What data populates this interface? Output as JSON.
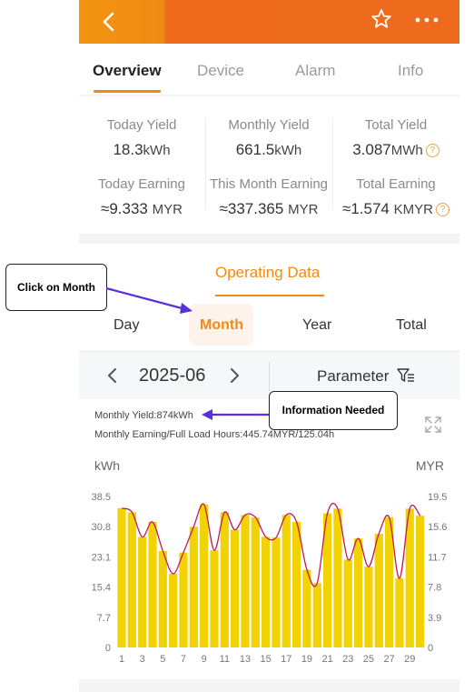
{
  "header": {
    "back_icon": "chevron-left-icon",
    "favorite_icon": "star-icon",
    "more_icon": "more-dots-icon",
    "gradient_left": "#f39410",
    "gradient_right": "#ee6a1c"
  },
  "tabs": [
    {
      "label": "Overview",
      "active": true
    },
    {
      "label": "Device",
      "active": false
    },
    {
      "label": "Alarm",
      "active": false
    },
    {
      "label": "Info",
      "active": false
    }
  ],
  "stats": {
    "today_yield": {
      "label": "Today Yield",
      "value": "18.3",
      "unit": "kWh"
    },
    "monthly_yield": {
      "label": "Monthly Yield",
      "value": "661.5",
      "unit": "kWh"
    },
    "total_yield": {
      "label": "Total Yield",
      "value": "3.087",
      "unit": "MWh"
    },
    "today_earning": {
      "label": "Today Earning",
      "value": "≈9.333",
      "unit": "MYR"
    },
    "month_earning": {
      "label": "This Month Earning",
      "value": "≈337.365",
      "unit": "MYR"
    },
    "total_earning": {
      "label": "Total Earning",
      "value": "≈1.574",
      "unit": "KMYR"
    },
    "help_glyph": "?"
  },
  "operating": {
    "title": "Operating Data",
    "periods": [
      "Day",
      "Month",
      "Year",
      "Total"
    ],
    "selected_period": "Month",
    "date": "2025-06",
    "parameter_label": "Parameter",
    "monthly_yield_text": "Monthly Yield:874kWh",
    "monthly_earning_text": "Monthly Earning/Full Load Hours:445.74MYR/125.04h"
  },
  "annotations": {
    "click_on_month": "Click on Month",
    "information_needed": "Information Needed",
    "arrow_color": "#5b2de0"
  },
  "chart_data": {
    "type": "bar",
    "left_axis_label": "kWh",
    "right_axis_label": "MYR",
    "y_ticks_left": [
      "0",
      "7.7",
      "15.4",
      "23.1",
      "30.8",
      "38.5"
    ],
    "y_ticks_right": [
      "0",
      "3.9",
      "7.8",
      "11.7",
      "15.6",
      "19.5"
    ],
    "ylim": [
      0,
      38.5
    ],
    "x_tick_labels": [
      "1",
      "3",
      "5",
      "7",
      "9",
      "11",
      "13",
      "15",
      "17",
      "19",
      "21",
      "23",
      "25",
      "27",
      "29"
    ],
    "categories": [
      "1",
      "2",
      "3",
      "4",
      "5",
      "6",
      "7",
      "8",
      "9",
      "10",
      "11",
      "12",
      "13",
      "14",
      "15",
      "16",
      "17",
      "18",
      "19",
      "20",
      "21",
      "22",
      "23",
      "24",
      "25",
      "26",
      "27",
      "28",
      "29",
      "30"
    ],
    "series": [
      {
        "values": [
          35.5,
          34.5,
          28.2,
          32.0,
          24.6,
          18.8,
          24.2,
          30.8,
          36.5,
          24.8,
          34.5,
          30.0,
          33.8,
          33.2,
          28.2,
          28.0,
          33.8,
          32.0,
          19.8,
          16.4,
          34.2,
          35.4,
          22.4,
          27.8,
          20.6,
          29.0,
          33.2,
          17.6,
          35.4,
          33.6
        ]
      }
    ],
    "bar_color": "#f2d200",
    "line_color": "#c2185b",
    "grid": false
  }
}
